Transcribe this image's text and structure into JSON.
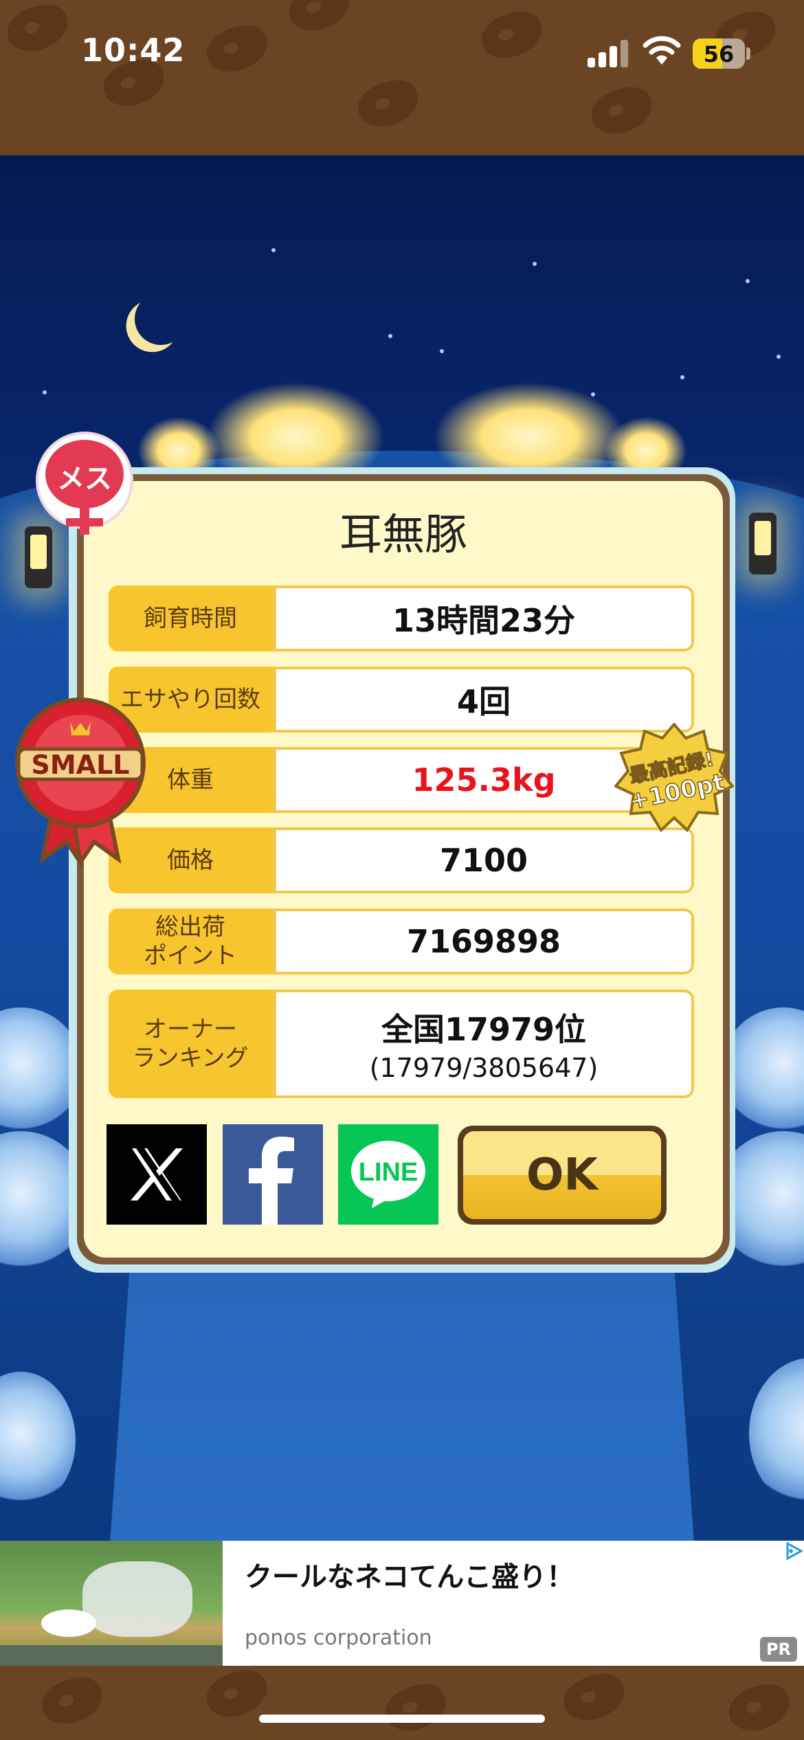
{
  "status_bar": {
    "time": "10:42",
    "battery": "56"
  },
  "dialog": {
    "title": "耳無豚",
    "rows": [
      {
        "label": "飼育時間",
        "value": "13時間23分"
      },
      {
        "label": "エサやり回数",
        "value": "4回"
      },
      {
        "label": "体重",
        "value": "125.3kg",
        "value_color": "#e8141d"
      },
      {
        "label": "価格",
        "value": "7100"
      },
      {
        "label": "総出荷\nポイント",
        "value": "7169898"
      },
      {
        "label": "オーナー\nランキング",
        "value": "全国17979位",
        "sub": "(17979/3805647)"
      }
    ],
    "share": {
      "x": "X",
      "facebook": "f",
      "line": "LINE"
    },
    "ok_label": "OK"
  },
  "badges": {
    "gender": "メス",
    "size": "SMALL",
    "record_line1": "最高記録!",
    "record_line2": "+100pt"
  },
  "ad": {
    "title": "クールなネコてんこ盛り！",
    "advertiser": "ponos corporation",
    "pr_label": "PR"
  },
  "colors": {
    "accent_yellow": "#f7c62f",
    "frame_brown": "#7a5a3a",
    "panel_cream": "#fff9c9",
    "highlight_red": "#e8141d"
  }
}
